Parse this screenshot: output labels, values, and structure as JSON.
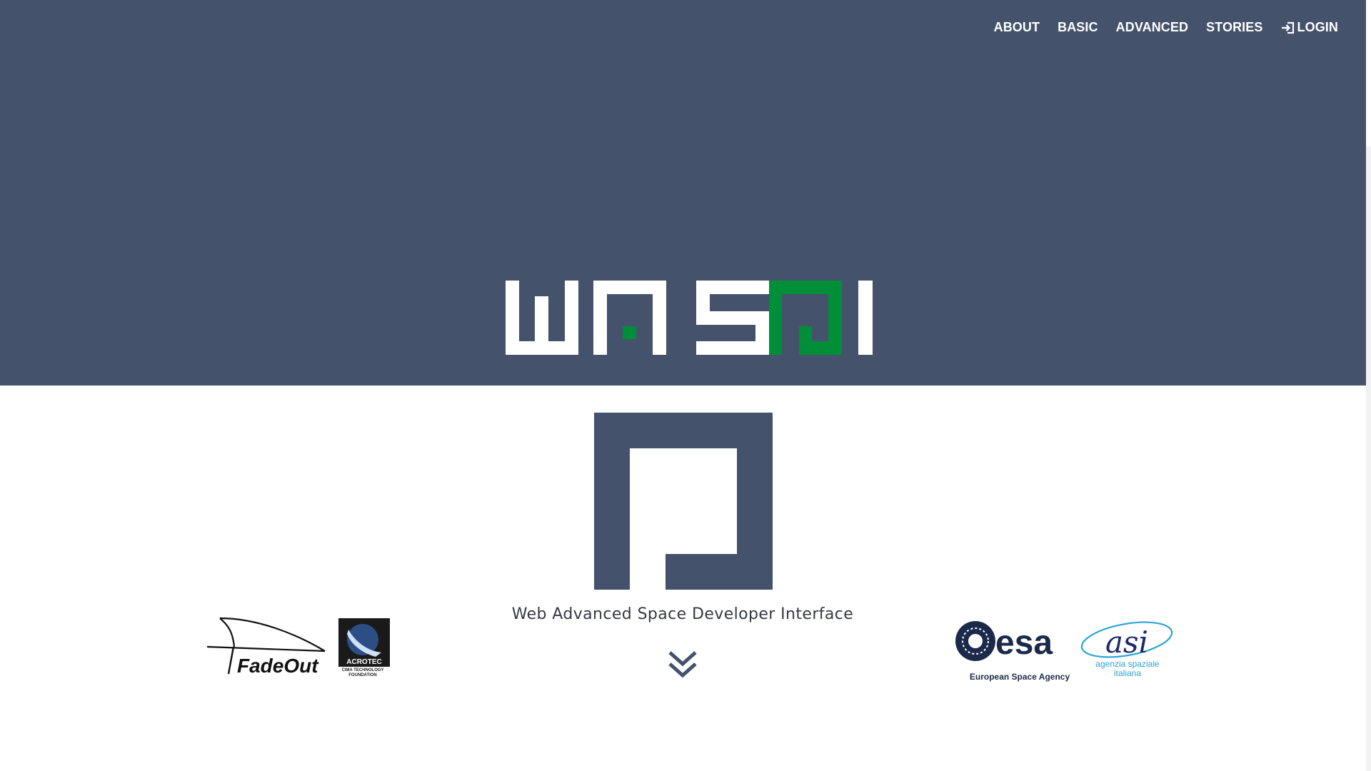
{
  "nav": {
    "items": [
      {
        "label": "ABOUT"
      },
      {
        "label": "BASIC"
      },
      {
        "label": "ADVANCED"
      },
      {
        "label": "STORIES"
      },
      {
        "label": "LOGIN",
        "icon": "login-icon"
      }
    ]
  },
  "brand": {
    "wordmark": "WASDI",
    "tagline": "Web Advanced Space Developer Interface"
  },
  "partners": {
    "fadeout": "FadeOut",
    "acrotec": "ACROTEC",
    "acrotec_caption": "CIMA TECHNOLOGY FOUNDATION",
    "esa": "esa",
    "esa_caption": "European Space Agency",
    "asi": "asi",
    "asi_caption_1": "agenzia spaziale",
    "asi_caption_2": "italiana"
  },
  "colors": {
    "hero_bg": "#44526b",
    "accent_green": "#008f39",
    "text_dark": "#333a44"
  },
  "icons": {
    "scroll_down": "double-chevron-down-icon",
    "login": "login-icon"
  }
}
